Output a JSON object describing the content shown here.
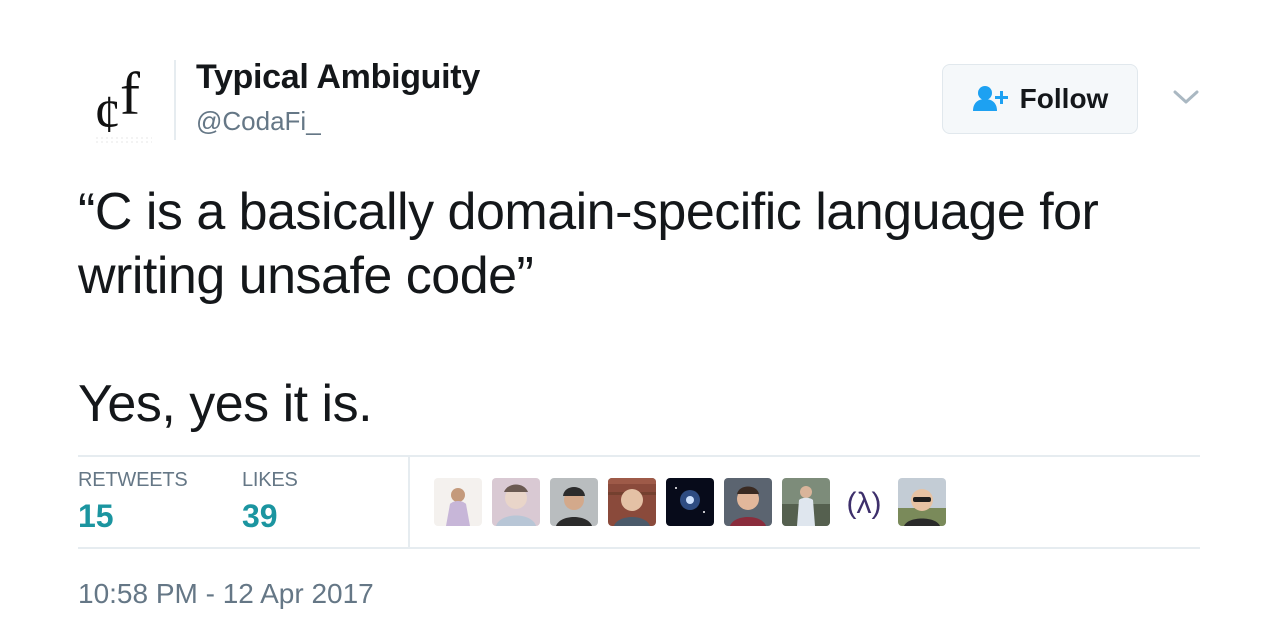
{
  "author": {
    "name": "Typical Ambiguity",
    "handle": "@CodaFi_",
    "logo_text": "¢f"
  },
  "follow_button": {
    "label": "Follow",
    "icon": "add-user-icon"
  },
  "more_menu": {
    "icon": "chevron-down-icon"
  },
  "tweet": {
    "line1": "“C is a basically domain-specific language for",
    "line2": "writing unsafe code”",
    "line3": "Yes, yes it is."
  },
  "stats": {
    "retweets_label": "RETWEETS",
    "retweets_value": "15",
    "likes_label": "LIKES",
    "likes_value": "39"
  },
  "likers": [
    {
      "icon": "liker-avatar-1"
    },
    {
      "icon": "liker-avatar-2"
    },
    {
      "icon": "liker-avatar-3"
    },
    {
      "icon": "liker-avatar-4"
    },
    {
      "icon": "liker-avatar-5"
    },
    {
      "icon": "liker-avatar-6"
    },
    {
      "icon": "liker-avatar-7"
    },
    {
      "icon": "liker-avatar-8",
      "text": "(λ)"
    },
    {
      "icon": "liker-avatar-9"
    }
  ],
  "timestamp": "10:58 PM - 12 Apr 2017",
  "colors": {
    "text": "#14171a",
    "secondary": "#657786",
    "stat_value": "#1b95a0",
    "follow_icon": "#1da1f2",
    "divider": "#e6ecf0"
  }
}
